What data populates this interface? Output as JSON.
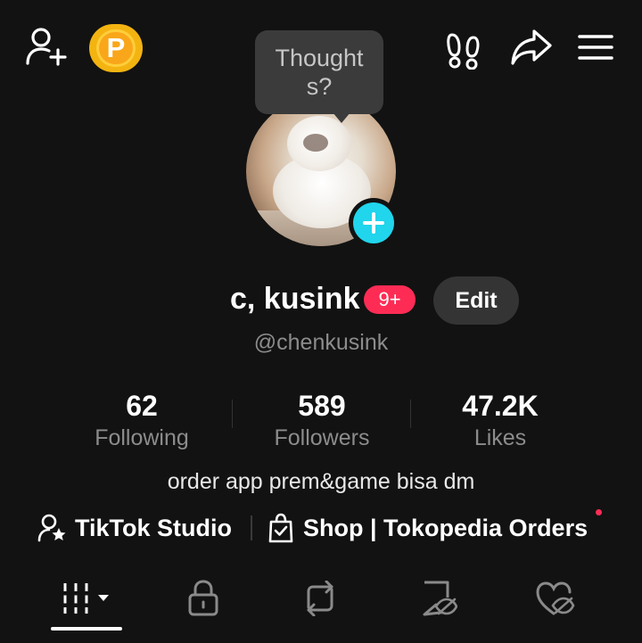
{
  "header": {
    "add_friend_icon": "add-user-icon",
    "coin_label": "P",
    "footprint_icon": "footprints-icon",
    "share_icon": "share-arrow-icon",
    "menu_icon": "hamburger-menu-icon"
  },
  "bubble": {
    "line1": "Thought",
    "line2": "s?"
  },
  "profile": {
    "name": "c, kusink",
    "notification_badge": "9+",
    "edit_label": "Edit",
    "handle": "@chenkusink"
  },
  "stats": [
    {
      "value": "62",
      "label": "Following"
    },
    {
      "value": "589",
      "label": "Followers"
    },
    {
      "value": "47.2K",
      "label": "Likes"
    }
  ],
  "bio": "order app prem&game bisa dm",
  "links": {
    "studio": "TikTok Studio",
    "shop": "Shop | Tokopedia Orders"
  },
  "tabs": [
    {
      "name": "videos-grid-icon",
      "active": true
    },
    {
      "name": "lock-icon",
      "active": false
    },
    {
      "name": "repost-icon",
      "active": false
    },
    {
      "name": "favorites-hidden-icon",
      "active": false
    },
    {
      "name": "liked-hidden-icon",
      "active": false
    }
  ],
  "colors": {
    "background": "#121212",
    "accent_red": "#fe2c55",
    "accent_cyan": "#20d5ec",
    "coin_gold": "#f9a61a"
  }
}
